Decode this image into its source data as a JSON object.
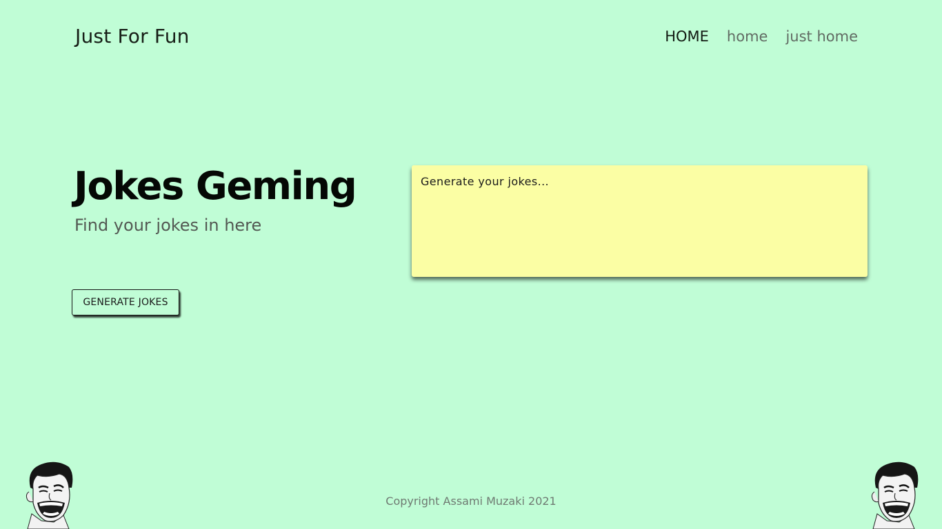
{
  "header": {
    "brand": "Just For Fun",
    "nav": [
      {
        "label": "HOME",
        "active": true
      },
      {
        "label": "home",
        "active": false
      },
      {
        "label": "just home",
        "active": false
      }
    ]
  },
  "hero": {
    "title": "Jokes Geming",
    "subtitle": "Find your jokes in here",
    "button_label": "GENERATE JOKES"
  },
  "joke_area": {
    "placeholder": "Generate your jokes...",
    "value": ""
  },
  "footer": {
    "copyright": "Copyright Assami Muzaki 2021"
  },
  "decorations": {
    "left_icon": "laughing-meme-face-icon",
    "right_icon": "laughing-meme-face-icon"
  },
  "colors": {
    "background": "#c0fdd6",
    "joke_box": "#fbfea4"
  }
}
